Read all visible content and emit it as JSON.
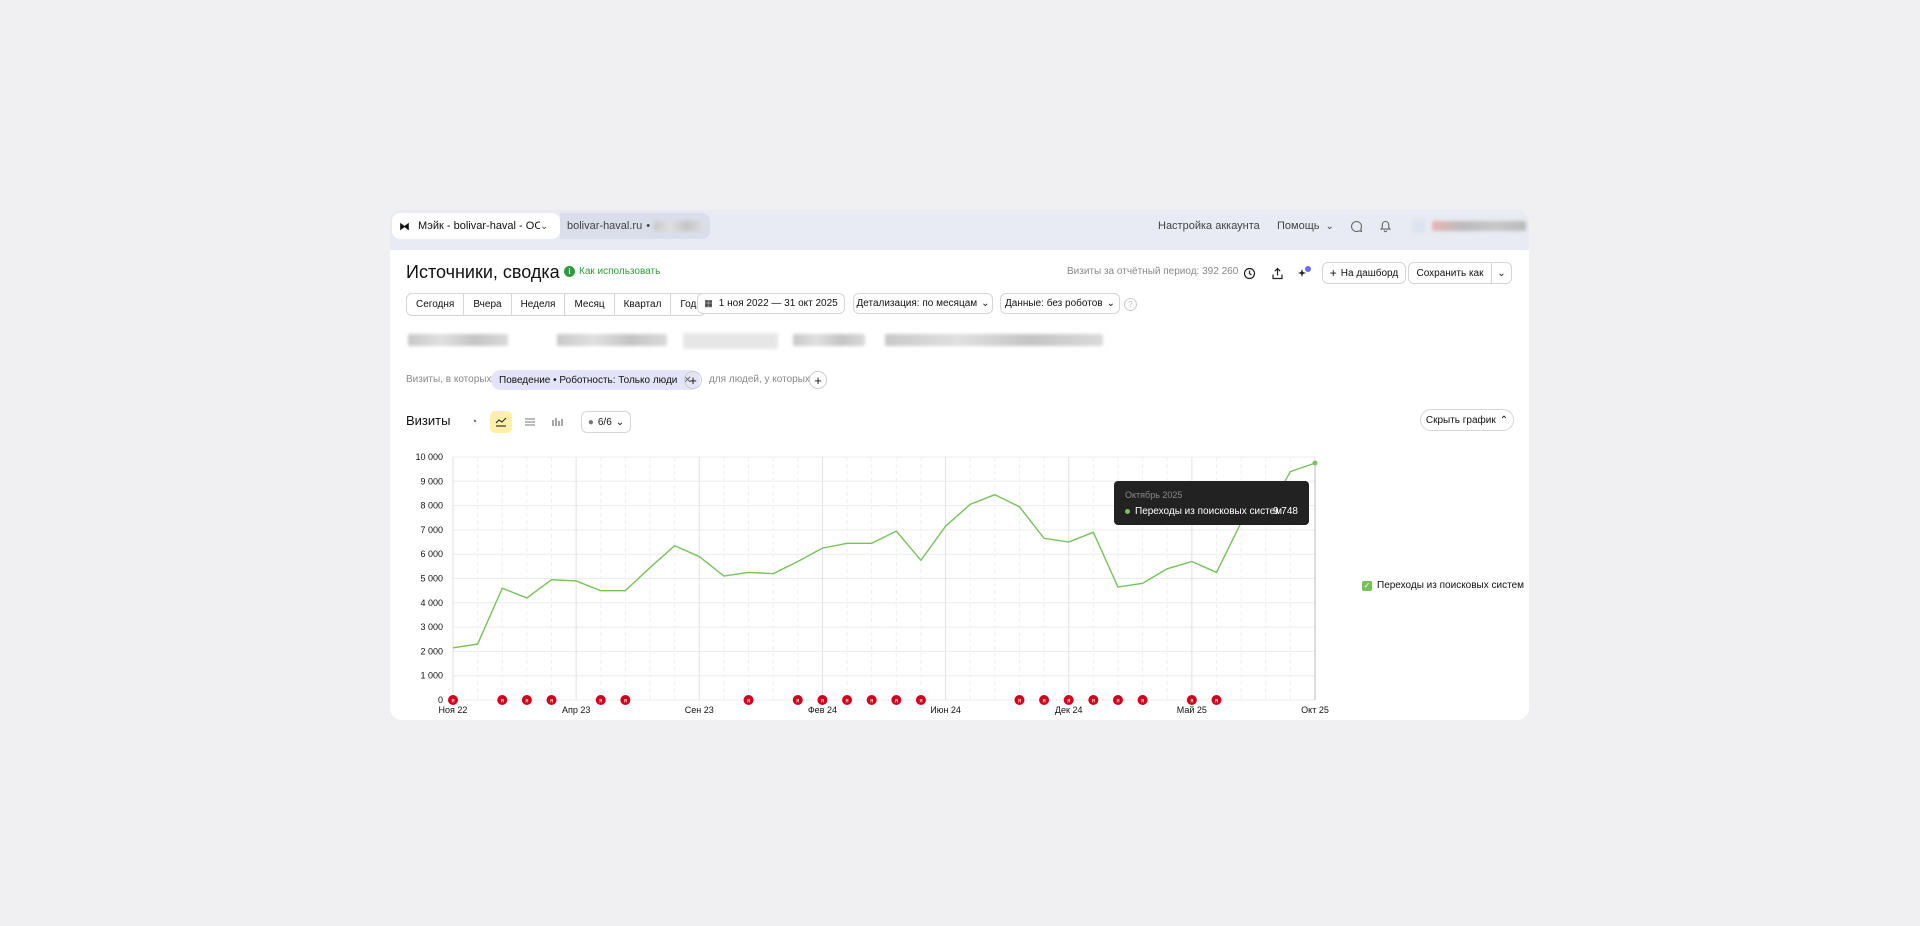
{
  "topbar": {
    "counter_name": "Мэйк - bolivar-haval - OO...",
    "site": "bolivar-haval.ru",
    "account_settings": "Настройка аккаунта",
    "help": "Помощь"
  },
  "header": {
    "title": "Источники, сводка",
    "how_to": "Как использовать",
    "visits_total": "Визиты за отчётный период: 392 260",
    "to_dashboard": "На дашборд",
    "save_as": "Сохранить как"
  },
  "periods": [
    "Сегодня",
    "Вчера",
    "Неделя",
    "Месяц",
    "Квартал",
    "Год"
  ],
  "date_range": "1 ноя 2022 — 31 окт 2025",
  "detail": "Детализация: по месяцам",
  "data_mode": "Данные: без роботов",
  "filters": {
    "visits_in_which": "Визиты, в которых",
    "chip": "Поведение • Роботность: Только люди",
    "for_people": "для людей, у которых"
  },
  "chart_header": {
    "title": "Визиты",
    "series_count": "6/6",
    "hide_chart": "Скрыть график"
  },
  "tooltip": {
    "month": "Октябрь 2025",
    "series": "Переходы из поисковых систем",
    "value": "9 748"
  },
  "colors": {
    "line": "#76c25a",
    "marker": "#d0021b",
    "accent_yellow": "#ffefa8",
    "chip": "#e4e4f8"
  },
  "chart_data": {
    "type": "line",
    "series": [
      {
        "name": "Переходы из поисковых систем",
        "values": [
          2150,
          2300,
          4600,
          4200,
          4950,
          4900,
          4500,
          4500,
          5450,
          6350,
          5900,
          5100,
          5250,
          5200,
          5700,
          6250,
          6450,
          6450,
          6950,
          5750,
          7150,
          8050,
          8450,
          7950,
          6650,
          6500,
          6900,
          4650,
          4800,
          5400,
          5700,
          5250,
          7300,
          7600,
          9400,
          9748
        ]
      }
    ],
    "x": [
      "2022-11",
      "2022-12",
      "2023-01",
      "2023-02",
      "2023-03",
      "2023-04",
      "2023-05",
      "2023-06",
      "2023-07",
      "2023-08",
      "2023-09",
      "2023-10",
      "2023-11",
      "2023-12",
      "2024-01",
      "2024-02",
      "2024-03",
      "2024-04",
      "2024-05",
      "2024-06",
      "2024-07",
      "2024-08",
      "2024-09",
      "2024-10",
      "2024-11",
      "2024-12",
      "2025-01",
      "2025-02",
      "2025-03",
      "2025-04",
      "2025-05",
      "2025-06",
      "2025-07",
      "2025-08",
      "2025-09",
      "2025-10"
    ],
    "x_tick_labels": [
      {
        "index": 0,
        "label": "Ноя 22"
      },
      {
        "index": 5,
        "label": "Апр 23"
      },
      {
        "index": 10,
        "label": "Сен 23"
      },
      {
        "index": 15,
        "label": "Фев 24"
      },
      {
        "index": 20,
        "label": "Июн 24"
      },
      {
        "index": 25,
        "label": "Дек 24"
      },
      {
        "index": 30,
        "label": "Май 25"
      },
      {
        "index": 35,
        "label": "Окт 25"
      }
    ],
    "y_ticks": [
      0,
      1000,
      2000,
      3000,
      4000,
      5000,
      6000,
      7000,
      8000,
      9000,
      10000
    ],
    "y_tick_labels": [
      "0",
      "1 000",
      "2 000",
      "3 000",
      "4 000",
      "5 000",
      "6 000",
      "7 000",
      "8 000",
      "9 000",
      "10 000"
    ],
    "ylim": [
      0,
      10000
    ],
    "grid": true,
    "legend": "right",
    "annotation_markers": [
      0,
      2,
      3,
      4,
      6,
      7,
      12,
      14,
      15,
      16,
      17,
      18,
      19,
      23,
      24,
      25,
      26,
      27,
      28,
      30,
      31
    ]
  }
}
